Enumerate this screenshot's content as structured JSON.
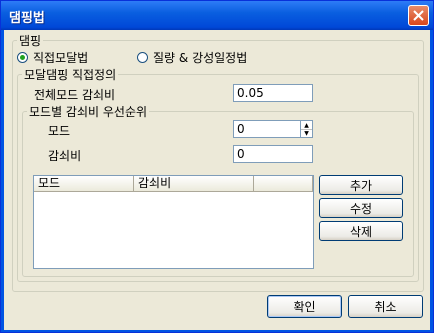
{
  "window": {
    "title": "댐핑법"
  },
  "damping_group": {
    "legend": "댐핑",
    "options": [
      {
        "label": "직접모달법",
        "selected": true
      },
      {
        "label": "질량 & 강성일정법",
        "selected": false
      }
    ]
  },
  "modal_group": {
    "legend": "모달댐핑 직접정의",
    "total_mode_label": "전체모드 감쇠비",
    "total_mode_value": "0.05"
  },
  "priority_group": {
    "legend": "모드별 감쇠비 우선순위",
    "mode_label": "모드",
    "mode_value": "0",
    "damping_label": "감쇠비",
    "damping_value": "0",
    "columns": [
      "모드",
      "감쇠비",
      ""
    ]
  },
  "side_buttons": {
    "add": "추가",
    "modify": "수정",
    "delete": "삭제"
  },
  "footer": {
    "ok": "확인",
    "cancel": "취소"
  }
}
